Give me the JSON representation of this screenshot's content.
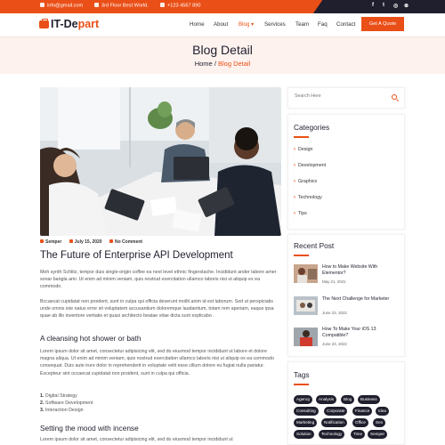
{
  "topbar": {
    "email": "info@gmail.com",
    "address": "3rd Floor Best World.",
    "phone": "+123 4567 890",
    "social": [
      "f",
      "t",
      "◎",
      "⊛"
    ]
  },
  "nav": {
    "logo_prefix": "IT-De",
    "logo_suffix": "part",
    "items": [
      "Home",
      "About",
      "Blog",
      "Services",
      "Team",
      "Faq",
      "Contact"
    ],
    "active_dropdown_arrow": "▾",
    "quote_button": "Get A Quote"
  },
  "hero": {
    "title": "Blog Detail",
    "crumb_home": "Home",
    "crumb_sep": " / ",
    "crumb_current": "Blog Detail"
  },
  "post": {
    "author": "Semper",
    "date": "July 15, 2020",
    "comments": "No Comment",
    "title": "The Future of Enterprise API Development",
    "para1": "Meh synth Schlitz, tempor duis single-origin coffee ea next level ethnic fingerstache. Incididunt ander labore amer sonar bangla ami. Ut enim ad minim veniam, quis nostrud exercitation ullamco laboris nisi ut aliquip ex ea commodo.",
    "para2": "Bccaecat cupidatat non proident, sunt in culpa qui officia deserunt mollit anim id est laborum. Sed ut perspiciatis unde omnis iste natus error sit voluptatem accusantium doloremque laudantium, totam rem aperiam, eaque ipsa quae ab illo inventore veritatis et quasi architecto beatae vitae dicta sunt explicabo .",
    "heading1": "A cleansing hot shower or bath",
    "para3": "Lorem ipsum dolor sit amet, consectetur adipisicing elit, sed do eiusmod tempor incididunt ut labore et dolore magna aliqua. Ut enim ad minim veniam, quis nostrud exercitation ullamco laboris nisi ut aliquip ex ea commodo consequat. Duis aute irure dolor in reprehenderit in voluptate velit esse cillum dolore eu fugiat nulla pariatur. Excepteur sint occaecat cupidatat non proident, sunt in culpa qui officia.",
    "list": [
      {
        "num": "1.",
        "text": "Digital Strategy"
      },
      {
        "num": "2.",
        "text": "Software Development"
      },
      {
        "num": "3.",
        "text": "Interaction Design"
      }
    ],
    "heading2": "Setting the mood with incense",
    "para4": "Lorem ipsum dolor sit amet, consectetur adipisicing elit, sed do eiusmod tempor incididunt ut"
  },
  "sidebar": {
    "search_placeholder": "Search Here",
    "categories_title": "Categories",
    "categories": [
      "Design",
      "Development",
      "Graphics",
      "Technology",
      "Tips"
    ],
    "recent_title": "Recent Post",
    "recent": [
      {
        "title": "How to Make Website With Elementor?",
        "date": "May 21, 2021"
      },
      {
        "title": "The Next Challenge for Marketer",
        "date": "June 23, 2022"
      },
      {
        "title": "How To Make Your iOS 13 Compatible?",
        "date": "June 23, 2022"
      }
    ],
    "tags_title": "Tags",
    "tags": [
      "Agency",
      "Analysis",
      "Blog",
      "Business",
      "Consulting",
      "Corporate",
      "Finance",
      "Idea",
      "Marketing",
      "Notification",
      "Office",
      "Seo",
      "Solution",
      "Technology",
      "Time",
      "Semper"
    ]
  },
  "colors": {
    "accent": "#ea4f17",
    "dark": "#1f1f2e",
    "hero_bg": "#fdf2ee"
  }
}
